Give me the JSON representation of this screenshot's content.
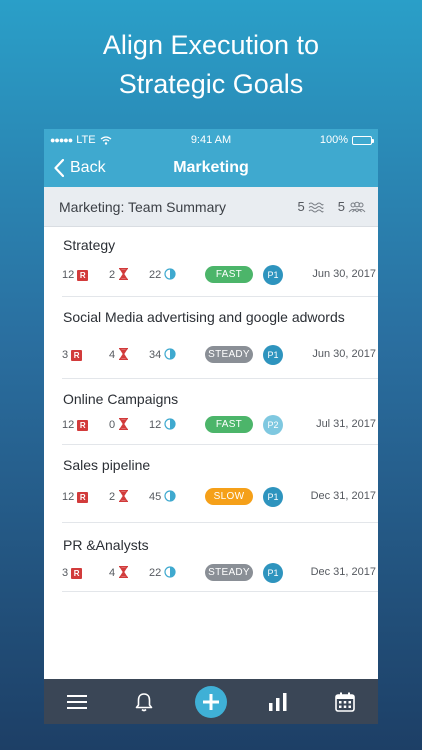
{
  "headline": {
    "line1": "Align Execution to",
    "line2": "Strategic Goals"
  },
  "status_bar": {
    "carrier": "LTE",
    "time": "9:41 AM",
    "battery": "100%"
  },
  "nav": {
    "back_label": "Back",
    "title": "Marketing"
  },
  "summary": {
    "title": "Marketing: Team Summary",
    "goals_count": "5",
    "members_count": "5"
  },
  "items": [
    {
      "name": "Strategy",
      "r_count": "12",
      "hourglass_count": "2",
      "progress_count": "22",
      "pace": "FAST",
      "pace_type": "fast",
      "priority": "P1",
      "date": "Jun 30, 2017"
    },
    {
      "name": "Social Media advertising and google adwords",
      "r_count": "3",
      "hourglass_count": "4",
      "progress_count": "34",
      "pace": "STEADY",
      "pace_type": "steady",
      "priority": "P1",
      "date": "Jun 30, 2017"
    },
    {
      "name": "Online Campaigns",
      "r_count": "12",
      "hourglass_count": "0",
      "progress_count": "12",
      "pace": "FAST",
      "pace_type": "fast",
      "priority": "P2",
      "date": "Jul 31, 2017"
    },
    {
      "name": "Sales pipeline",
      "r_count": "12",
      "hourglass_count": "2",
      "progress_count": "45",
      "pace": "SLOW",
      "pace_type": "slow",
      "priority": "P1",
      "date": "Dec 31, 2017"
    },
    {
      "name": "PR &Analysts",
      "r_count": "3",
      "hourglass_count": "4",
      "progress_count": "22",
      "pace": "STEADY",
      "pace_type": "steady",
      "priority": "P1",
      "date": "Dec 31, 2017"
    }
  ],
  "badge_r": "R",
  "tabbar": {
    "icons": [
      "menu-icon",
      "bell-icon",
      "plus-icon",
      "bar-chart-icon",
      "calendar-icon"
    ]
  },
  "colors": {
    "accent": "#3fa9cf",
    "fast": "#4cb56a",
    "steady": "#8a8f96",
    "slow": "#f5a019",
    "priority": "#2e94be",
    "tabbar": "#3a4656"
  }
}
